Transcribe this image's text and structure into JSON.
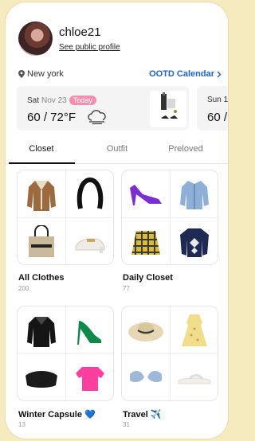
{
  "profile": {
    "username": "chloe21",
    "see_profile": "See public profile"
  },
  "location": {
    "city": "New york",
    "calendar_link": "OOTD Calendar"
  },
  "weather": {
    "day": "Sat",
    "date": "Nov 23",
    "badge": "Today",
    "temp": "60 / 72°F",
    "next_day": "Sun 1",
    "next_temp": "60 /"
  },
  "tabs": [
    "Closet",
    "Outfit",
    "Preloved"
  ],
  "collections": [
    {
      "name": "All Clothes",
      "count": "200",
      "items": [
        "shearling-jacket",
        "black-headband",
        "tote-bag",
        "loafers"
      ]
    },
    {
      "name": "Daily Closet",
      "count": "77",
      "items": [
        "purple-heels",
        "denim-jacket",
        "plaid-skirt",
        "argyle-sweater"
      ]
    },
    {
      "name": "Winter Capsule",
      "emoji": "💙",
      "count": "13",
      "items": [
        "leather-jacket",
        "green-heels",
        "black-clutch",
        "pink-top"
      ]
    },
    {
      "name": "Travel",
      "emoji": "✈️",
      "count": "31",
      "items": [
        "straw-hat",
        "floral-dress",
        "blue-bikini",
        "white-sandals"
      ]
    }
  ],
  "colors": {
    "link": "#1e63c9",
    "today_badge": "#f48fb1",
    "background": "#f5ebbf"
  }
}
